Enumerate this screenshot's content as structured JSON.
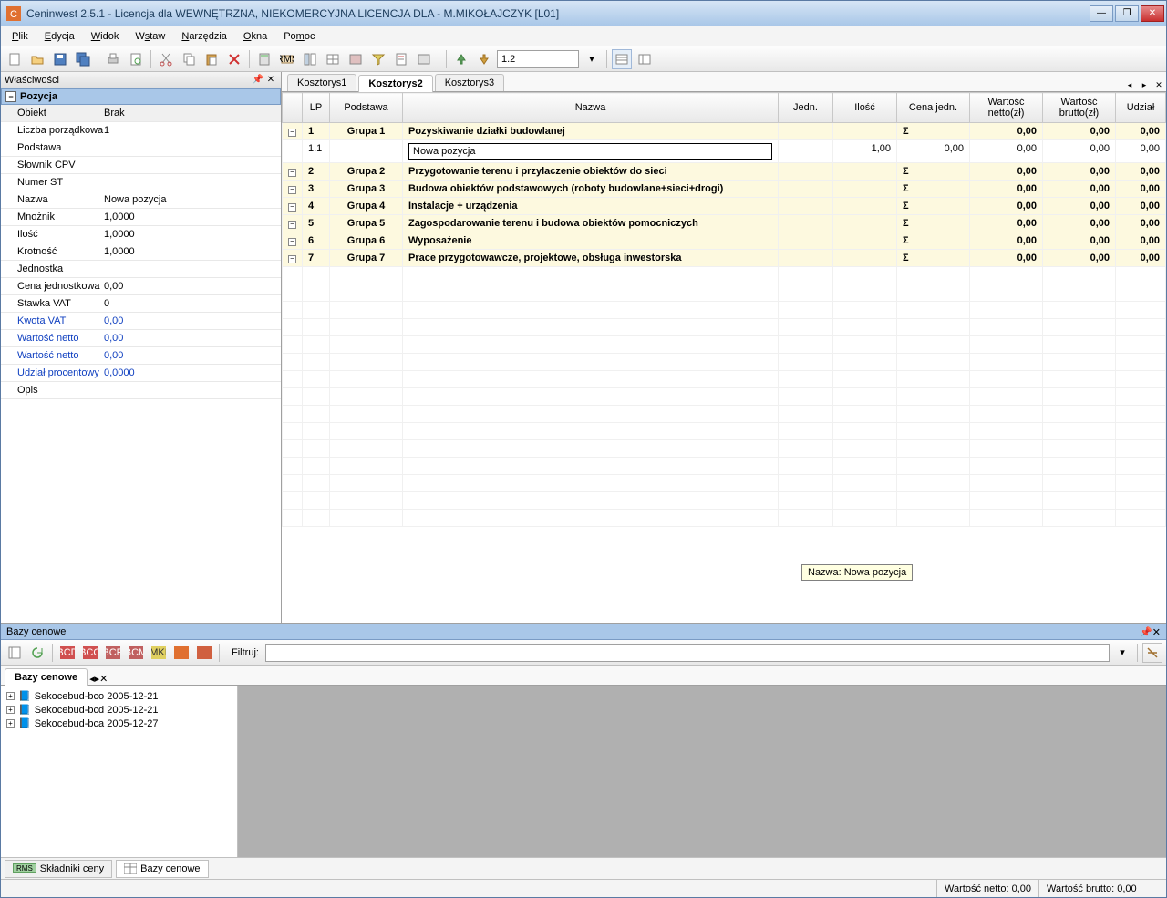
{
  "title": "Ceninwest 2.5.1 - Licencja dla WEWNĘTRZNA, NIEKOMERCYJNA LICENCJA DLA - M.MIKOŁAJCZYK [L01]",
  "menu": {
    "plik": "Plik",
    "edycja": "Edycja",
    "widok": "Widok",
    "wstaw": "Wstaw",
    "narzedzia": "Narzędzia",
    "okna": "Okna",
    "pomoc": "Pomoc"
  },
  "toolbar": {
    "spin_value": "1.2"
  },
  "properties_panel": {
    "title": "Właściwości",
    "section": "Pozycja",
    "rows": [
      {
        "k": "Obiekt",
        "v": "Brak",
        "gray": true
      },
      {
        "k": "Liczba porządkowa",
        "v": "1"
      },
      {
        "k": "Podstawa",
        "v": ""
      },
      {
        "k": "Słownik CPV",
        "v": ""
      },
      {
        "k": "Numer ST",
        "v": ""
      },
      {
        "k": "Nazwa",
        "v": "Nowa pozycja"
      },
      {
        "k": "Mnożnik",
        "v": "1,0000"
      },
      {
        "k": "Ilość",
        "v": "1,0000"
      },
      {
        "k": "Krotność",
        "v": "1,0000"
      },
      {
        "k": "Jednostka",
        "v": ""
      },
      {
        "k": "Cena jednostkowa",
        "v": "0,00"
      },
      {
        "k": "Stawka VAT",
        "v": "0"
      },
      {
        "k": "Kwota VAT",
        "v": "0,00",
        "blue": true
      },
      {
        "k": "Wartość netto",
        "v": "0,00",
        "blue": true
      },
      {
        "k": "Wartość netto",
        "v": "0,00",
        "blue": true
      },
      {
        "k": "Udział procentowy",
        "v": "0,0000",
        "blue": true
      },
      {
        "k": "Opis",
        "v": ""
      }
    ]
  },
  "doc_tabs": [
    "Kosztorys1",
    "Kosztorys2",
    "Kosztorys3"
  ],
  "doc_tab_active": 1,
  "grid": {
    "columns": [
      "",
      "LP",
      "Podstawa",
      "Nazwa",
      "Jedn.",
      "Ilość",
      "Cena jedn.",
      "Wartość netto(zł)",
      "Wartość brutto(zł)",
      "Udział"
    ],
    "rows": [
      {
        "type": "group",
        "lp": "1",
        "podstawa": "Grupa 1",
        "nazwa": "Pozyskiwanie działki budowlanej",
        "cena": "Σ",
        "netto": "0,00",
        "brutto": "0,00",
        "udzial": "0,00"
      },
      {
        "type": "item",
        "lp": "1.1",
        "podstawa": "",
        "nazwa": "Nowa pozycja",
        "ilosc": "1,00",
        "cena": "0,00",
        "netto": "0,00",
        "brutto": "0,00",
        "udzial": "0,00",
        "editing": true
      },
      {
        "type": "group",
        "lp": "2",
        "podstawa": "Grupa 2",
        "nazwa": "Przygotowanie terenu i przyłaczenie obiektów do sieci",
        "cena": "Σ",
        "netto": "0,00",
        "brutto": "0,00",
        "udzial": "0,00"
      },
      {
        "type": "group",
        "lp": "3",
        "podstawa": "Grupa 3",
        "nazwa": "Budowa obiektów podstawowych (roboty budowlane+sieci+drogi)",
        "cena": "Σ",
        "netto": "0,00",
        "brutto": "0,00",
        "udzial": "0,00"
      },
      {
        "type": "group",
        "lp": "4",
        "podstawa": "Grupa 4",
        "nazwa": "Instalacje + urządzenia",
        "cena": "Σ",
        "netto": "0,00",
        "brutto": "0,00",
        "udzial": "0,00"
      },
      {
        "type": "group",
        "lp": "5",
        "podstawa": "Grupa 5",
        "nazwa": "Zagospodarowanie terenu i budowa obiektów pomocniczych",
        "cena": "Σ",
        "netto": "0,00",
        "brutto": "0,00",
        "udzial": "0,00"
      },
      {
        "type": "group",
        "lp": "6",
        "podstawa": "Grupa 6",
        "nazwa": "Wyposażenie",
        "cena": "Σ",
        "netto": "0,00",
        "brutto": "0,00",
        "udzial": "0,00"
      },
      {
        "type": "group",
        "lp": "7",
        "podstawa": "Grupa 7",
        "nazwa": "Prace przygotowawcze, projektowe, obsługa inwestorska",
        "cena": "Σ",
        "netto": "0,00",
        "brutto": "0,00",
        "udzial": "0,00"
      }
    ]
  },
  "tooltip": "Nazwa: Nowa pozycja",
  "bottom": {
    "title": "Bazy cenowe",
    "filter_label": "Filtruj:",
    "tab": "Bazy cenowe",
    "tree": [
      "Sekocebud-bco 2005-12-21",
      "Sekocebud-bcd 2005-12-21",
      "Sekocebud-bca 2005-12-27"
    ]
  },
  "footer_tabs": {
    "rms": "Składniki ceny",
    "bazy": "Bazy cenowe",
    "rms_badge": "RMS"
  },
  "status": {
    "netto": "Wartość netto: 0,00",
    "brutto": "Wartość brutto: 0,00"
  }
}
